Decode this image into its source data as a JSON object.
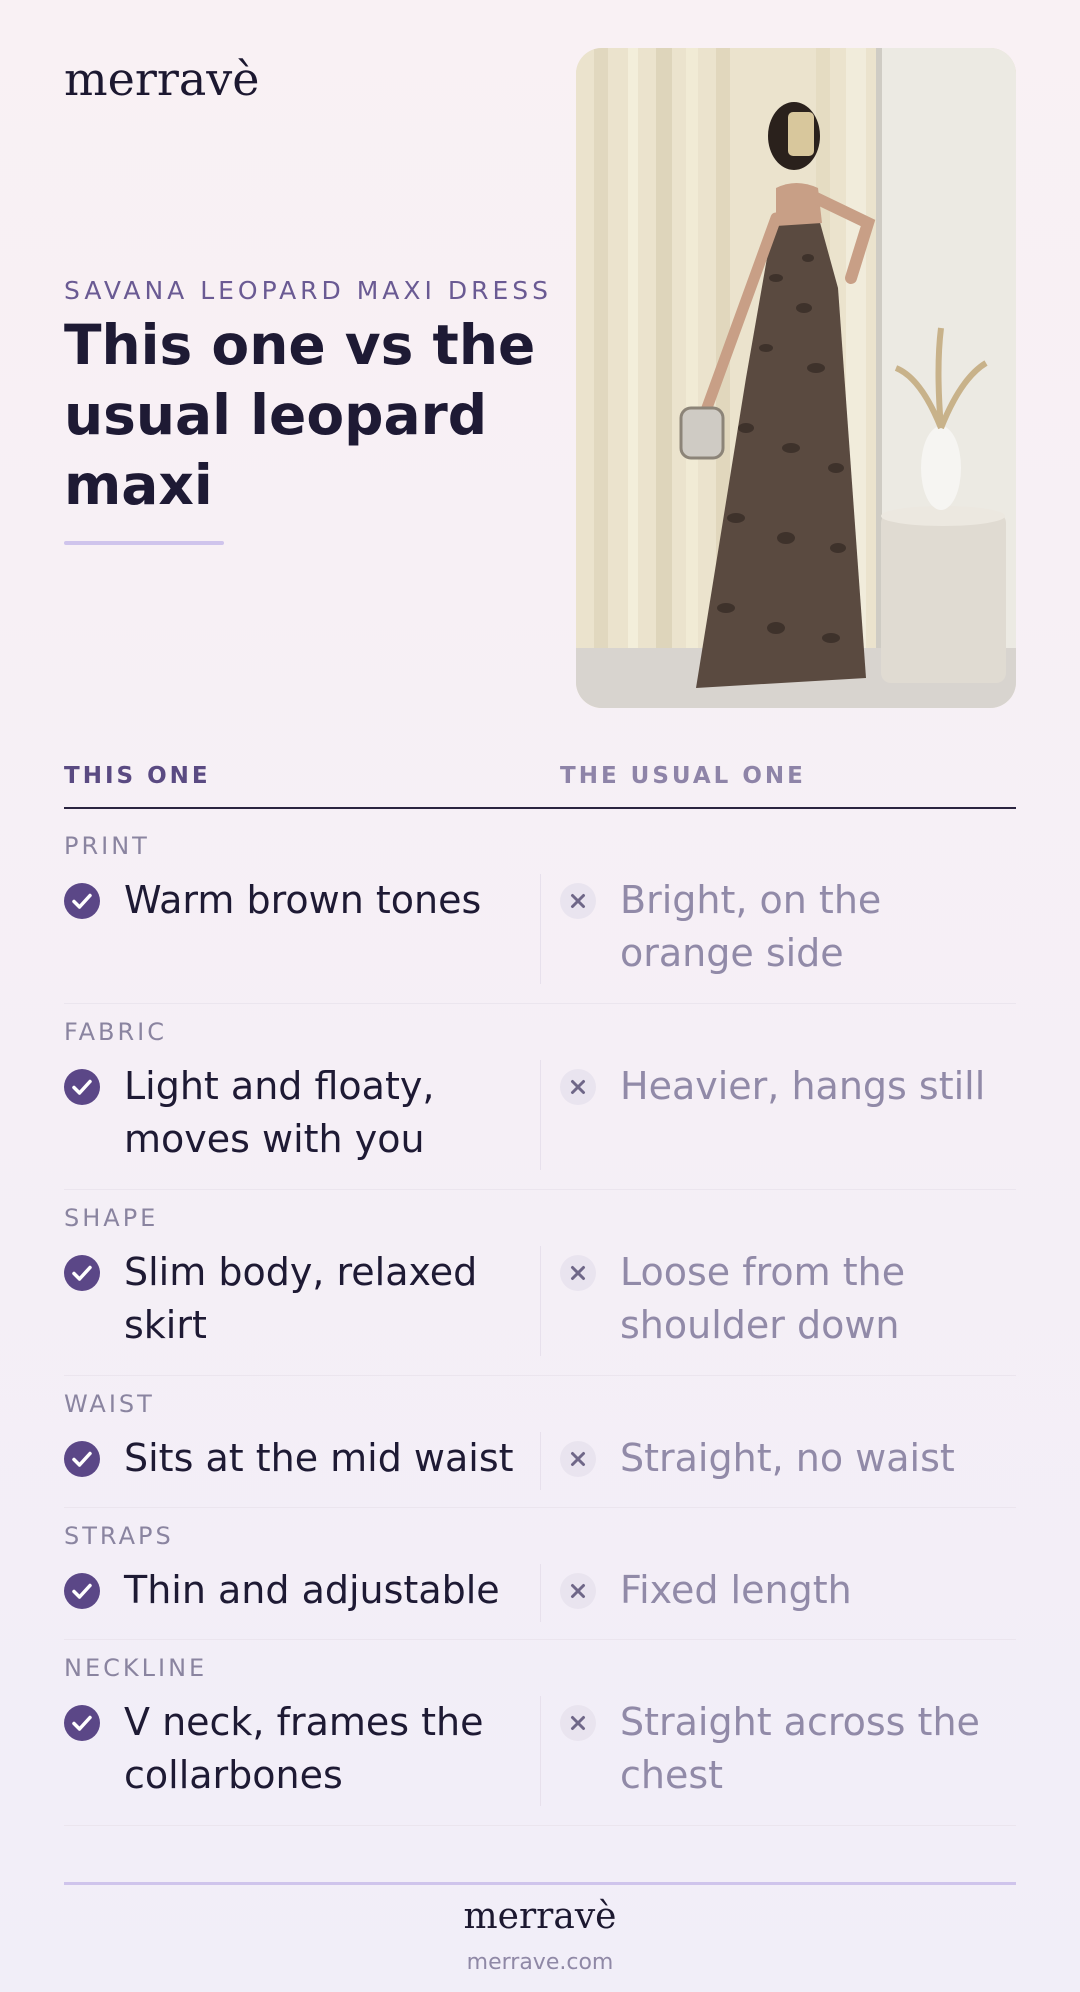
{
  "brand": {
    "logo": "merravè"
  },
  "hero": {
    "eyebrow": "SAVANA LEOPARD MAXI DRESS",
    "headline": "This one vs the usual leopard maxi"
  },
  "comparison": {
    "this_label": "THIS ONE",
    "usual_label": "THE USUAL ONE",
    "rows": [
      {
        "category": "PRINT",
        "this": "Warm brown tones",
        "usual": "Bright, on the orange side"
      },
      {
        "category": "FABRIC",
        "this": "Light and floaty, moves with you",
        "usual": "Heavier, hangs still"
      },
      {
        "category": "SHAPE",
        "this": "Slim body, relaxed skirt",
        "usual": "Loose from the shoulder down"
      },
      {
        "category": "WAIST",
        "this": "Sits at the mid waist",
        "usual": "Straight, no waist"
      },
      {
        "category": "STRAPS",
        "this": "Thin and adjustable",
        "usual": "Fixed length"
      },
      {
        "category": "NECKLINE",
        "this": "V neck, frames the collarbones",
        "usual": "Straight across the chest"
      }
    ]
  },
  "footer": {
    "logo": "merravè",
    "url": "merrave.com"
  },
  "colors": {
    "accent": "#5b4787",
    "muted": "#918aa8",
    "background": "#f7f0f5"
  }
}
